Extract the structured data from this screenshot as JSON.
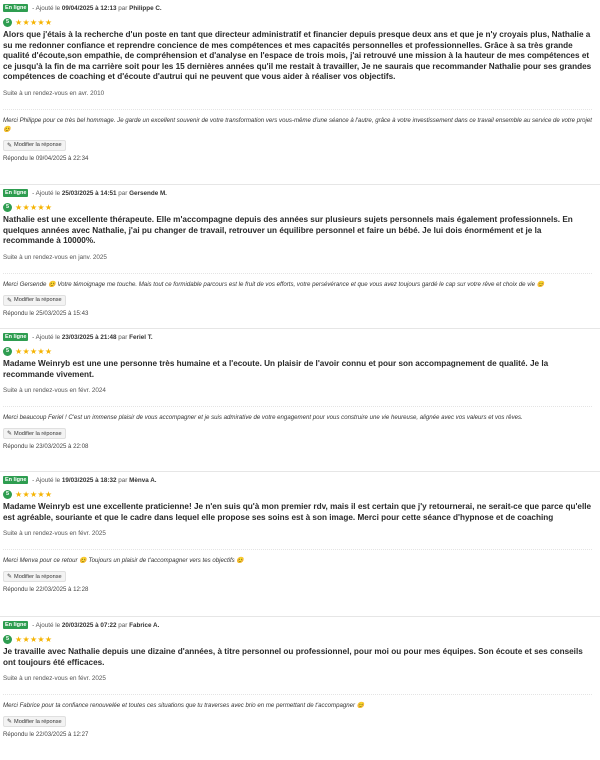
{
  "reviews": [
    {
      "status": "En ligne",
      "added_prefix": " - Ajouté le ",
      "date": "09/04/2025 à 12:13",
      "by": " par ",
      "author": "Philippe C.",
      "score": "5",
      "stars": "★★★★★",
      "text": "Alors que j'étais à la recherche d'un poste en tant que directeur administratif et financier depuis presque deux ans et que je n'y croyais plus, Nathalie a su me redonner confiance et reprendre concience de mes compétences et mes capacités personnelles et professionnelles. Grâce à sa très grande qualité d'écoute,son empathie, de compréhension et d'analyse en l'espace de trois mois, j'ai retrouvé une mission à la hauteur de mes compétences et ce jusqu'à la fin de ma carrière soit pour les 15 dernières années qu'il me restait à travailler, Je ne saurais que recommander Nathalie pour ses grandes compétences de coaching et d'écoute d'autrui qui ne peuvent que vous aider à réaliser vos objectifs.",
      "visit": "Suite à un rendez-vous en avr. 2010",
      "reply": "Merci Philippe pour ce très bel hommage. Je garde un excellent souvenir de votre transformation vers vous-même d'une séance à l'autre, grâce à votre investissement dans ce travail ensemble au service de votre projet 😊",
      "edit_label": "Modifier la réponse",
      "replied": "Répondu le 09/04/2025 à 22:34"
    },
    {
      "status": "En ligne",
      "added_prefix": " - Ajouté le ",
      "date": "25/03/2025 à 14:51",
      "by": " par ",
      "author": "Gersende M.",
      "score": "5",
      "stars": "★★★★★",
      "text": "Nathalie est une excellente thérapeute. Elle m'accompagne depuis des années sur plusieurs sujets personnels mais également professionnels. En quelques années avec Nathalie, j'ai pu changer de travail, retrouver un équilibre personnel et faire un bébé. Je lui dois énormément et je la recommande à 10000%.",
      "visit": "Suite à un rendez-vous en janv. 2025",
      "reply": "Merci Gersende 😊 Votre témoignage me touche. Mais tout ce formidable parcours est le fruit de vos efforts, votre persévérance et que vous avez toujours gardé le cap sur votre rêve et choix de vie 😊",
      "edit_label": "Modifier la réponse",
      "replied": "Répondu le 25/03/2025 à 15:43"
    },
    {
      "status": "En ligne",
      "added_prefix": " - Ajouté le ",
      "date": "23/03/2025 à 21:48",
      "by": " par ",
      "author": "Feriel T.",
      "score": "5",
      "stars": "★★★★★",
      "text": "Madame Weinryb est une une personne très humaine et a l'ecoute. Un plaisir de l'avoir connu et pour son accompagnement de qualité. Je la recommande vivement.",
      "visit": "Suite à un rendez-vous en févr. 2024",
      "reply": "Merci beaucoup Feriel ! C'est un immense plaisir de vous accompagner et je suis admirative de votre engagement pour vous construire une vie heureuse, alignée avec vos valeurs et vos rêves.",
      "edit_label": "Modifier la réponse",
      "replied": "Répondu le 23/03/2025 à 22:08"
    },
    {
      "status": "En ligne",
      "added_prefix": " - Ajouté le ",
      "date": "19/03/2025 à 18:32",
      "by": " par ",
      "author": "Mènva A.",
      "score": "5",
      "stars": "★★★★★",
      "text": "Madame Weinryb est une excellente praticienne! Je n'en suis qu'à mon premier rdv, mais il est certain que j'y retournerai, ne serait-ce que parce qu'elle est agréable, souriante et que le cadre dans lequel elle propose ses soins est à son image. Merci pour cette séance d'hypnose et de coaching",
      "visit": "Suite à un rendez-vous en févr. 2025",
      "reply": "Merci Menva pour ce retour 😊 Toujours un plaisir de t'accompagner vers tes objectifs 😊",
      "edit_label": "Modifier la réponse",
      "replied": "Répondu le 22/03/2025 à 12:28"
    },
    {
      "status": "En ligne",
      "added_prefix": " - Ajouté le ",
      "date": "20/03/2025 à 07:22",
      "by": " par ",
      "author": "Fabrice A.",
      "score": "5",
      "stars": "★★★★★",
      "text": "Je travaille avec Nathalie depuis une dizaine d'années, à titre personnel ou professionnel, pour moi ou pour mes équipes. Son écoute et ses conseils ont toujours été efficaces.",
      "visit": "Suite à un rendez-vous en févr. 2025",
      "reply": "Merci Fabrice pour ta confiance renouvelée et toutes ces situations que tu traverses avec brio en me permettant de t'accompagner 😊",
      "edit_label": "Modifier la réponse",
      "replied": "Répondu le 22/03/2025 à 12:27"
    }
  ]
}
